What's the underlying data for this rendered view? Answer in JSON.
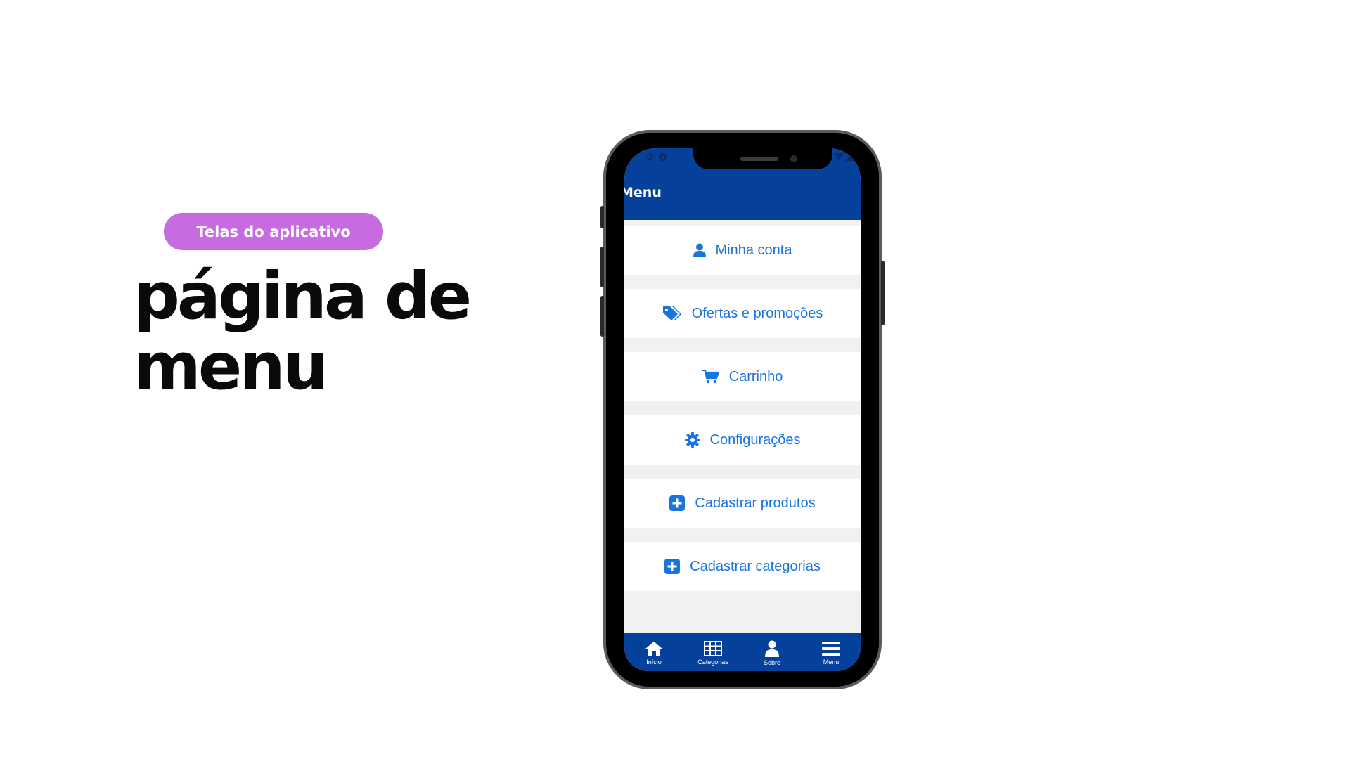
{
  "page": {
    "badge": "Telas do aplicativo",
    "headline_line1": "página de",
    "headline_line2": "menu"
  },
  "app": {
    "title": "Menu",
    "colors": {
      "primary": "#05409a",
      "accent": "#1875de",
      "badge": "#c66be0"
    },
    "menu_items": [
      {
        "label": "Minha conta",
        "icon": "user-icon"
      },
      {
        "label": "Ofertas e promoções",
        "icon": "tags-icon"
      },
      {
        "label": "Carrinho",
        "icon": "cart-icon"
      },
      {
        "label": "Configurações",
        "icon": "gear-icon"
      },
      {
        "label": "Cadastrar produtos",
        "icon": "plus-square-icon"
      },
      {
        "label": "Cadastrar categorias",
        "icon": "plus-square-icon"
      }
    ],
    "bottom_nav": [
      {
        "label": "Início",
        "icon": "home-icon"
      },
      {
        "label": "Categorias",
        "icon": "grid-icon"
      },
      {
        "label": "Sobre",
        "icon": "user-icon"
      },
      {
        "label": "Menu",
        "icon": "hamburger-icon"
      }
    ]
  }
}
